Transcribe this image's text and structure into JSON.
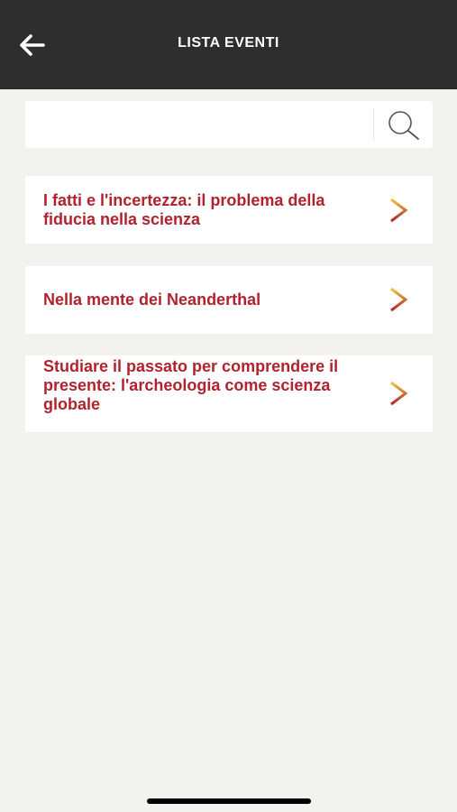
{
  "header": {
    "title": "LISTA EVENTI",
    "back_icon": "arrow-left-icon"
  },
  "search": {
    "value": "",
    "placeholder": "",
    "icon": "search-icon"
  },
  "events": [
    {
      "title": "I fatti e l'incertezza: il problema della fiducia nella scienza",
      "icon": "chevron-right-icon"
    },
    {
      "title": "Nella mente dei Neanderthal",
      "icon": "chevron-right-icon"
    },
    {
      "title": "Studiare il passato per comprendere il presente: l'archeologia come scienza globale",
      "icon": "chevron-right-icon"
    }
  ],
  "colors": {
    "header_bg": "#2e2e2e",
    "page_bg": "#f3f2ef",
    "title_red": "#b0232e",
    "chevron_start": "#f0c437",
    "chevron_end": "#b0232e"
  }
}
